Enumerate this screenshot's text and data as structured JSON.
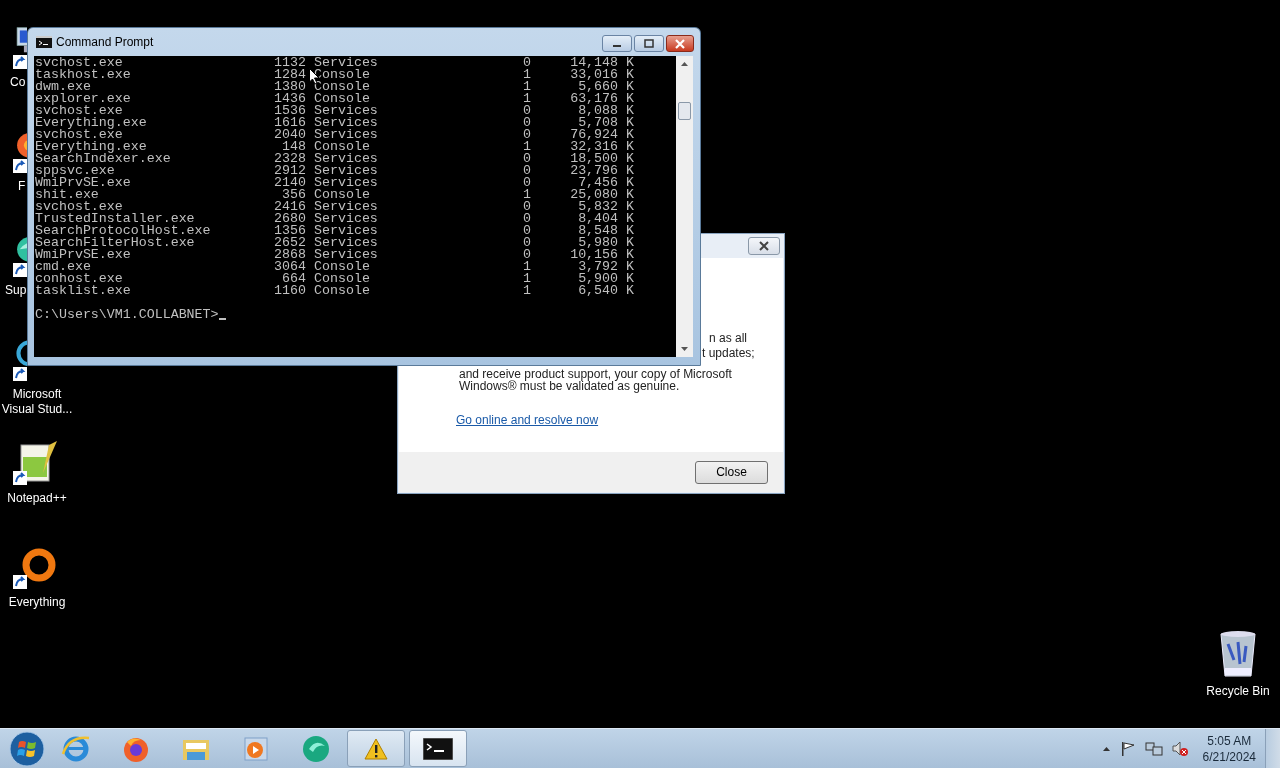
{
  "desktop_icons": [
    {
      "label": "Co",
      "kind": "computer"
    },
    {
      "label": "F",
      "kind": "firefox"
    },
    {
      "label": "Sup",
      "kind": "support"
    },
    {
      "label": "Microsoft Visual Stud...",
      "kind": "visual_studio"
    },
    {
      "label": "Notepad++",
      "kind": "notepad"
    },
    {
      "label": "Everything",
      "kind": "everything"
    }
  ],
  "recycle_bin": {
    "label": "Recycle Bin"
  },
  "dialog": {
    "body_lines": [
      "n as all",
      "t updates;",
      "and receive product support, your copy of Microsoft",
      "Windows® must be validated as genuine."
    ],
    "link": "Go online and resolve now",
    "button": "Close"
  },
  "console": {
    "title": "Command Prompt",
    "rows": [
      {
        "image": "svchost.exe",
        "pid": "1132",
        "session_name": "Services",
        "session_number": "0",
        "mem_usage": "14,148 K"
      },
      {
        "image": "taskhost.exe",
        "pid": "1284",
        "session_name": "Console",
        "session_number": "1",
        "mem_usage": "33,016 K"
      },
      {
        "image": "dwm.exe",
        "pid": "1380",
        "session_name": "Console",
        "session_number": "1",
        "mem_usage": "5,660 K"
      },
      {
        "image": "explorer.exe",
        "pid": "1436",
        "session_name": "Console",
        "session_number": "1",
        "mem_usage": "63,176 K"
      },
      {
        "image": "svchost.exe",
        "pid": "1536",
        "session_name": "Services",
        "session_number": "0",
        "mem_usage": "8,088 K"
      },
      {
        "image": "Everything.exe",
        "pid": "1616",
        "session_name": "Services",
        "session_number": "0",
        "mem_usage": "5,708 K"
      },
      {
        "image": "svchost.exe",
        "pid": "2040",
        "session_name": "Services",
        "session_number": "0",
        "mem_usage": "76,924 K"
      },
      {
        "image": "Everything.exe",
        "pid": "148",
        "session_name": "Console",
        "session_number": "1",
        "mem_usage": "32,316 K"
      },
      {
        "image": "SearchIndexer.exe",
        "pid": "2328",
        "session_name": "Services",
        "session_number": "0",
        "mem_usage": "18,500 K"
      },
      {
        "image": "sppsvc.exe",
        "pid": "2912",
        "session_name": "Services",
        "session_number": "0",
        "mem_usage": "23,796 K"
      },
      {
        "image": "WmiPrvSE.exe",
        "pid": "2140",
        "session_name": "Services",
        "session_number": "0",
        "mem_usage": "7,456 K"
      },
      {
        "image": "shit.exe",
        "pid": "356",
        "session_name": "Console",
        "session_number": "1",
        "mem_usage": "25,080 K"
      },
      {
        "image": "svchost.exe",
        "pid": "2416",
        "session_name": "Services",
        "session_number": "0",
        "mem_usage": "5,832 K"
      },
      {
        "image": "TrustedInstaller.exe",
        "pid": "2680",
        "session_name": "Services",
        "session_number": "0",
        "mem_usage": "8,404 K"
      },
      {
        "image": "SearchProtocolHost.exe",
        "pid": "1356",
        "session_name": "Services",
        "session_number": "0",
        "mem_usage": "8,548 K"
      },
      {
        "image": "SearchFilterHost.exe",
        "pid": "2652",
        "session_name": "Services",
        "session_number": "0",
        "mem_usage": "5,980 K"
      },
      {
        "image": "WmiPrvSE.exe",
        "pid": "2868",
        "session_name": "Services",
        "session_number": "0",
        "mem_usage": "10,156 K"
      },
      {
        "image": "cmd.exe",
        "pid": "3064",
        "session_name": "Console",
        "session_number": "1",
        "mem_usage": "3,792 K"
      },
      {
        "image": "conhost.exe",
        "pid": "664",
        "session_name": "Console",
        "session_number": "1",
        "mem_usage": "5,900 K"
      },
      {
        "image": "tasklist.exe",
        "pid": "1160",
        "session_name": "Console",
        "session_number": "1",
        "mem_usage": "6,540 K"
      }
    ],
    "prompt": "C:\\Users\\VM1.COLLABNET>"
  },
  "clock": {
    "time": "5:05 AM",
    "date": "6/21/2024"
  }
}
